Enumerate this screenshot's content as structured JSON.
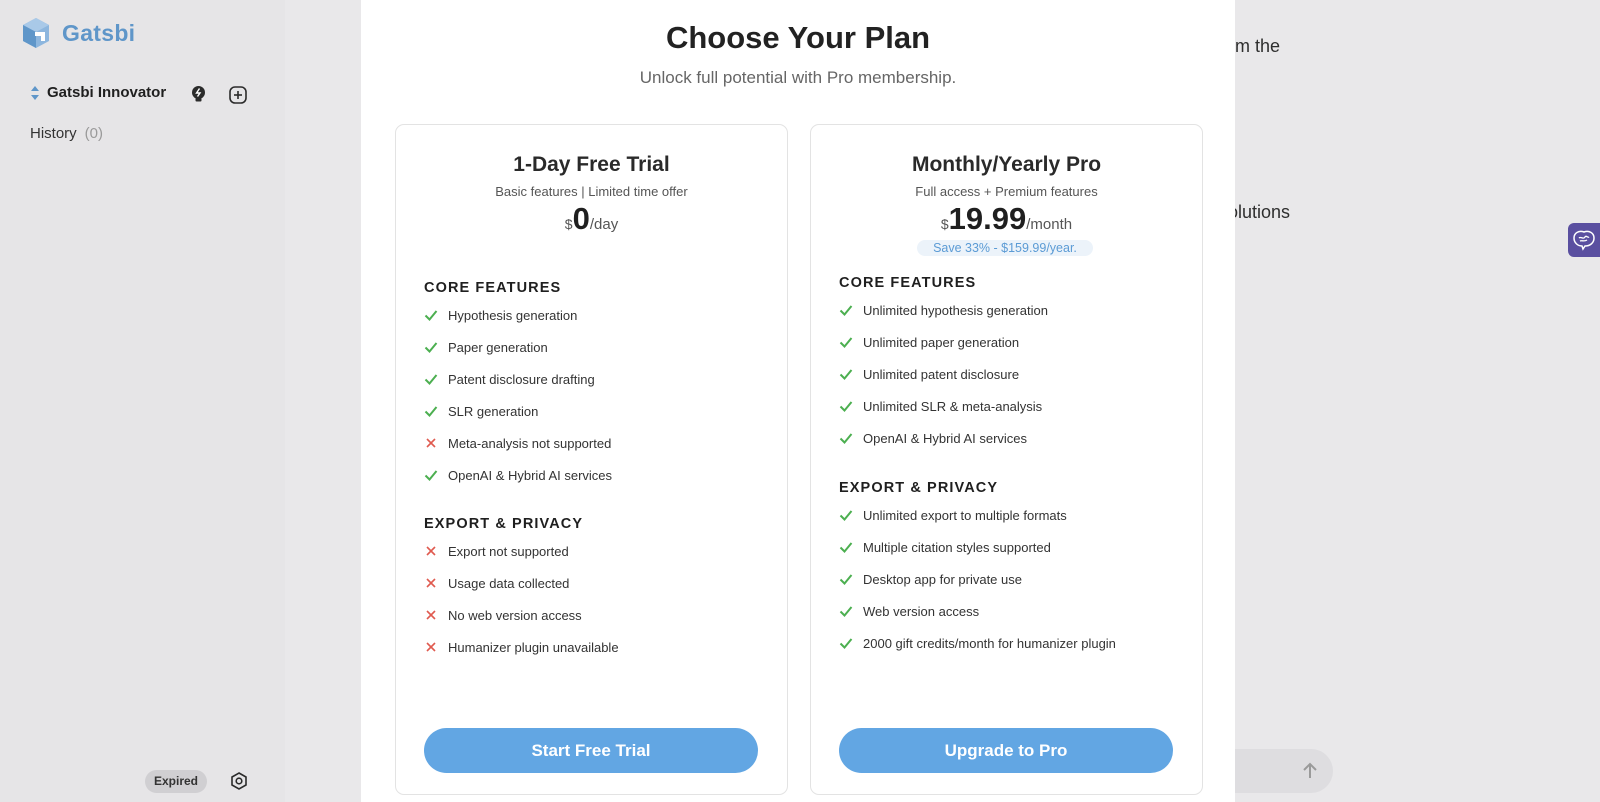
{
  "app": {
    "brand": "Gatsbi",
    "workspace_name": "Gatsbi Innovator",
    "history_label": "History",
    "history_count": "(0)",
    "status_badge": "Expired",
    "accent_color": "#62a6e3"
  },
  "background": {
    "text_fragment_1": "om the",
    "text_fragment_2": "olutions"
  },
  "modal": {
    "title": "Choose Your Plan",
    "subtitle": "Unlock full potential with Pro membership."
  },
  "plans": {
    "trial": {
      "name": "1-Day Free Trial",
      "tagline": "Basic features | Limited time offer",
      "currency": "$",
      "amount": "0",
      "period": "/day",
      "core_heading": "CORE FEATURES",
      "core_features": [
        {
          "text": "Hypothesis generation",
          "included": true
        },
        {
          "text": "Paper generation",
          "included": true
        },
        {
          "text": "Patent disclosure drafting",
          "included": true
        },
        {
          "text": "SLR generation",
          "included": true
        },
        {
          "text": "Meta-analysis not supported",
          "included": false
        },
        {
          "text": "OpenAI & Hybrid AI services",
          "included": true
        }
      ],
      "export_heading": "EXPORT & PRIVACY",
      "export_features": [
        {
          "text": "Export not supported",
          "included": false
        },
        {
          "text": "Usage data collected",
          "included": false
        },
        {
          "text": "No web version access",
          "included": false
        },
        {
          "text": "Humanizer plugin unavailable",
          "included": false
        }
      ],
      "cta": "Start Free Trial"
    },
    "pro": {
      "name": "Monthly/Yearly Pro",
      "tagline": "Full access + Premium features",
      "currency": "$",
      "amount": "19.99",
      "period": "/month",
      "save_note": "Save 33% - $159.99/year.",
      "core_heading": "CORE FEATURES",
      "core_features": [
        {
          "text": "Unlimited hypothesis generation",
          "included": true
        },
        {
          "text": "Unlimited paper generation",
          "included": true
        },
        {
          "text": "Unlimited patent disclosure",
          "included": true
        },
        {
          "text": "Unlimited SLR & meta-analysis",
          "included": true
        },
        {
          "text": "OpenAI & Hybrid AI services",
          "included": true
        }
      ],
      "export_heading": "EXPORT & PRIVACY",
      "export_features": [
        {
          "text": "Unlimited export to multiple formats",
          "included": true
        },
        {
          "text": "Multiple citation styles supported",
          "included": true
        },
        {
          "text": "Desktop app for private use",
          "included": true
        },
        {
          "text": "Web version access",
          "included": true
        },
        {
          "text": "2000 gift credits/month for humanizer plugin",
          "included": true
        }
      ],
      "cta": "Upgrade to Pro"
    }
  },
  "icons": {
    "logo": "gatsbi-logo-icon",
    "sort": "sort-arrows-icon",
    "idea": "lightbulb-icon",
    "add": "plus-circle-icon",
    "settings": "settings-icon",
    "assistant": "brain-icon",
    "send": "arrow-up-icon",
    "included": "check-icon",
    "excluded": "cross-icon"
  },
  "colors": {
    "check": "#4caf50",
    "cross": "#e05a4f",
    "brand_text": "#5f96c9",
    "assistant_tab": "#5a4fa0"
  }
}
